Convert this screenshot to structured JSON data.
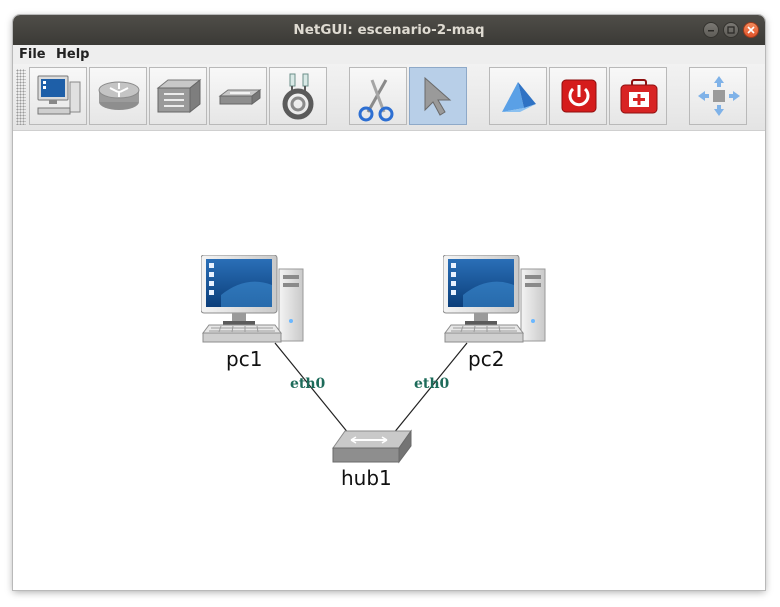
{
  "window": {
    "title": "NetGUI: escenario-2-maq"
  },
  "menubar": {
    "file": "File",
    "help": "Help"
  },
  "toolbar": {
    "tools": [
      {
        "icon": "terminal-pc-icon",
        "active": false
      },
      {
        "icon": "router-icon",
        "active": false
      },
      {
        "icon": "switch-icon",
        "active": false
      },
      {
        "icon": "hub-icon",
        "active": false
      },
      {
        "icon": "cable-icon",
        "active": false
      },
      {
        "icon": "scissors-icon",
        "active": false
      },
      {
        "icon": "pointer-arrow-icon",
        "active": true
      },
      {
        "icon": "start-icon",
        "active": false
      },
      {
        "icon": "power-off-icon",
        "active": false
      },
      {
        "icon": "first-aid-kit-icon",
        "active": false
      },
      {
        "icon": "center-view-icon",
        "active": false
      }
    ]
  },
  "canvas": {
    "nodes": [
      {
        "id": "pc1",
        "label": "pc1",
        "type": "pc"
      },
      {
        "id": "pc2",
        "label": "pc2",
        "type": "pc"
      },
      {
        "id": "hub1",
        "label": "hub1",
        "type": "hub"
      }
    ],
    "links": [
      {
        "from": "pc1",
        "to": "hub1",
        "interface": "eth0"
      },
      {
        "from": "pc2",
        "to": "hub1",
        "interface": "eth0"
      }
    ]
  }
}
